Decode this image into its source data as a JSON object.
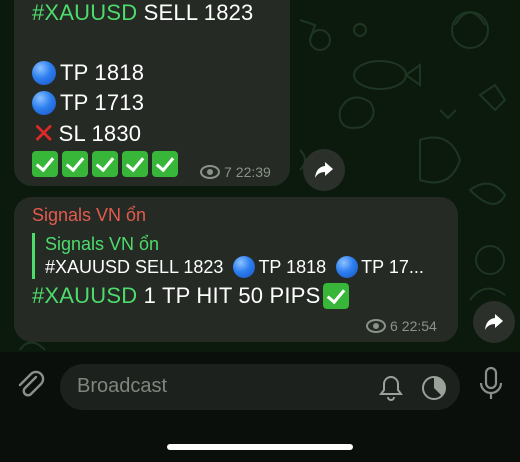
{
  "messages": [
    {
      "lines": [
        {
          "hashtag": "#XAUUSD",
          "text": "SELL 1823"
        },
        {
          "text": "TP 1818"
        },
        {
          "text": "TP 1713"
        },
        {
          "text": "SL 1830"
        }
      ],
      "checks": 5,
      "views": "7",
      "time": "22:39"
    },
    {
      "sender": "Signals VN ổn",
      "reply": {
        "name": "Signals VN ổn",
        "part1": "#XAUUSD SELL 1823",
        "part2": "TP 1818",
        "part3": "TP 17..."
      },
      "hashtag": "#XAUUSD",
      "text": "1 TP HIT 50 PIPS",
      "views": "6",
      "time": "22:54"
    }
  ],
  "composer": {
    "placeholder": "Broadcast"
  },
  "icons": [
    "attach-icon",
    "bell-icon",
    "timer-icon",
    "microphone-icon",
    "share-icon",
    "eye-icon"
  ]
}
